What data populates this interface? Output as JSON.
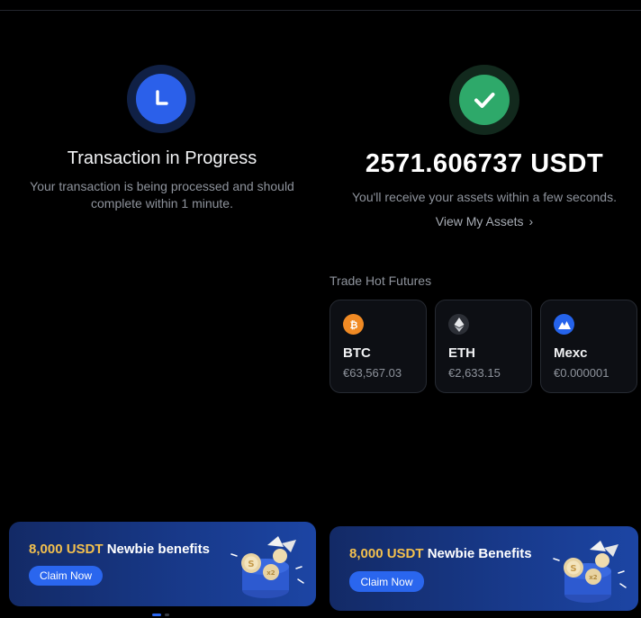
{
  "pending": {
    "title": "Transaction in Progress",
    "description": "Your transaction is being processed and should complete within 1 minute.",
    "icon": "clock-icon"
  },
  "success": {
    "amount": "2571.606737 USDT",
    "message": "You'll receive your assets within a few seconds.",
    "view_assets_label": "View My Assets",
    "icon": "checkmark-icon"
  },
  "futures": {
    "title": "Trade Hot Futures",
    "items": [
      {
        "name": "BTC",
        "price": "€63,567.03",
        "icon": "bitcoin-icon",
        "color": "#f08a24"
      },
      {
        "name": "ETH",
        "price": "€2,633.15",
        "icon": "ethereum-icon",
        "color": "#2c2f36"
      },
      {
        "name": "Mexc",
        "price": "€0.000001",
        "icon": "mexc-icon",
        "color": "#2563eb"
      }
    ]
  },
  "banners": [
    {
      "highlight": "8,000 USDT",
      "text": "Newbie benefits",
      "button": "Claim Now"
    },
    {
      "highlight": "8,000 USDT",
      "text": "Newbie Benefits",
      "button": "Claim Now"
    }
  ],
  "colors": {
    "background": "#000000",
    "accent": "#2a66ee",
    "success": "#2ea96a",
    "gold": "#f3c04e"
  }
}
